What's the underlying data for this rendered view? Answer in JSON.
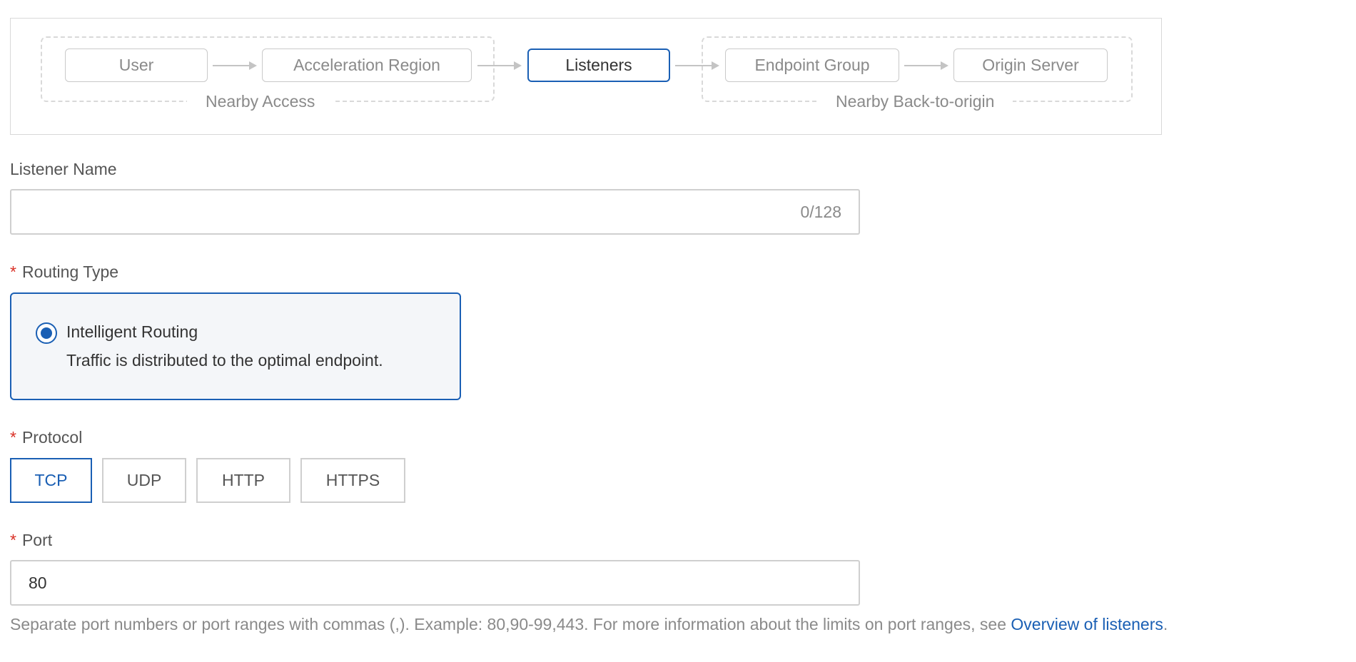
{
  "flow": {
    "nodes": {
      "user": "User",
      "acceleration_region": "Acceleration Region",
      "listeners": "Listeners",
      "endpoint_group": "Endpoint Group",
      "origin_server": "Origin Server"
    },
    "groups": {
      "nearby_access": "Nearby Access",
      "nearby_back_to_origin": "Nearby Back-to-origin"
    },
    "active_node": "Listeners"
  },
  "form": {
    "listener_name": {
      "label": "Listener Name",
      "value": "",
      "counter": "0/128"
    },
    "routing_type": {
      "required_mark": "*",
      "label": "Routing Type",
      "option_title": "Intelligent Routing",
      "option_description": "Traffic is distributed to the optimal endpoint.",
      "selected": true
    },
    "protocol": {
      "required_mark": "*",
      "label": "Protocol",
      "options": [
        "TCP",
        "UDP",
        "HTTP",
        "HTTPS"
      ],
      "selected": "TCP"
    },
    "port": {
      "required_mark": "*",
      "label": "Port",
      "value": "80",
      "help_text": "Separate port numbers or port ranges with commas (,). Example: 80,90-99,443. For more information about the limits on port ranges, see ",
      "help_link": "Overview of listeners",
      "help_suffix": "."
    }
  },
  "colors": {
    "accent": "#1a5fb4",
    "required": "#d93026",
    "muted_text": "#8a8a8a",
    "border": "#cfcfcf"
  }
}
